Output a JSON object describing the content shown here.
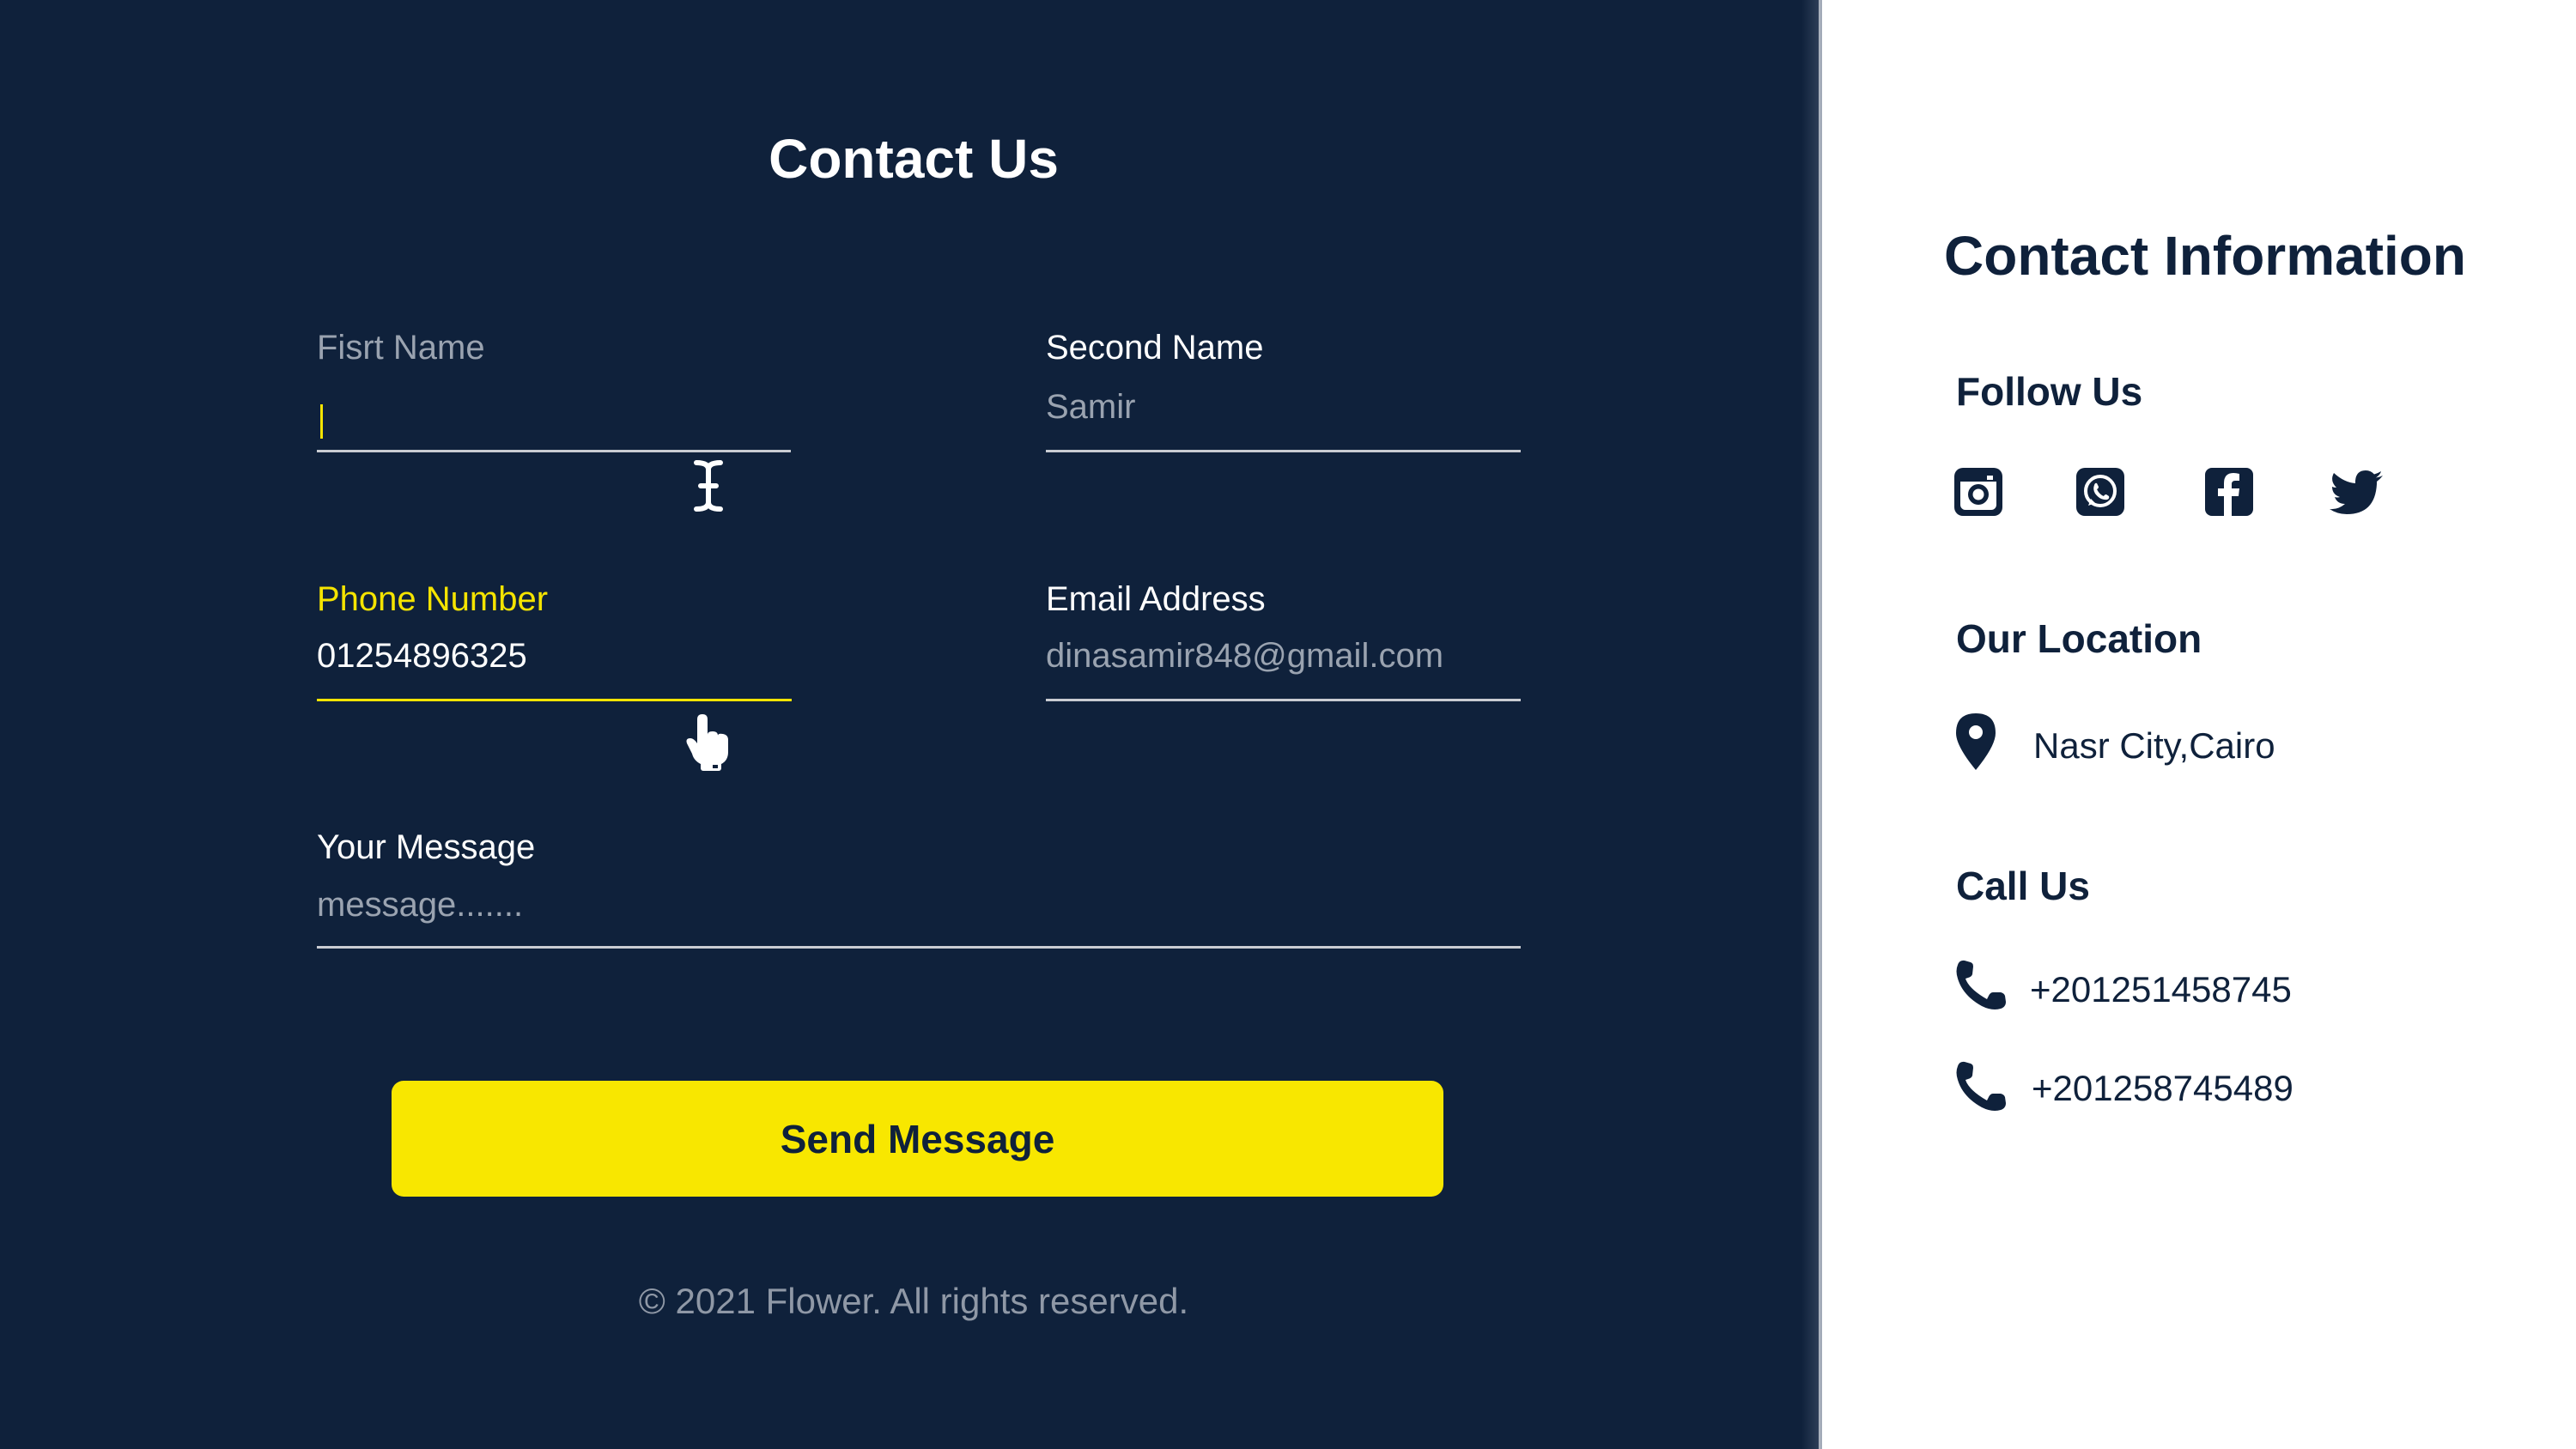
{
  "form": {
    "title": "Contact Us",
    "first_name": {
      "label": "Fisrt Name",
      "value": ""
    },
    "second_name": {
      "label": "Second Name",
      "placeholder": "Samir"
    },
    "phone": {
      "label": "Phone Number",
      "value": "01254896325"
    },
    "email": {
      "label": "Email Address",
      "placeholder": "dinasamir848@gmail.com"
    },
    "message": {
      "label": "Your Message",
      "placeholder": "message......."
    },
    "submit_label": "Send Message",
    "footer": "© 2021 Flower. All rights reserved."
  },
  "contact": {
    "title": "Contact Information",
    "follow_heading": "Follow Us",
    "social_icons": [
      "instagram-icon",
      "whatsapp-icon",
      "facebook-icon",
      "twitter-icon"
    ],
    "location_heading": "Our Location",
    "location": "Nasr City,Cairo",
    "call_heading": "Call Us",
    "phones": [
      "+201251458745",
      "+201258745489"
    ]
  },
  "colors": {
    "background": "#0f213b",
    "accent": "#f8e700",
    "panel": "#ffffff"
  }
}
